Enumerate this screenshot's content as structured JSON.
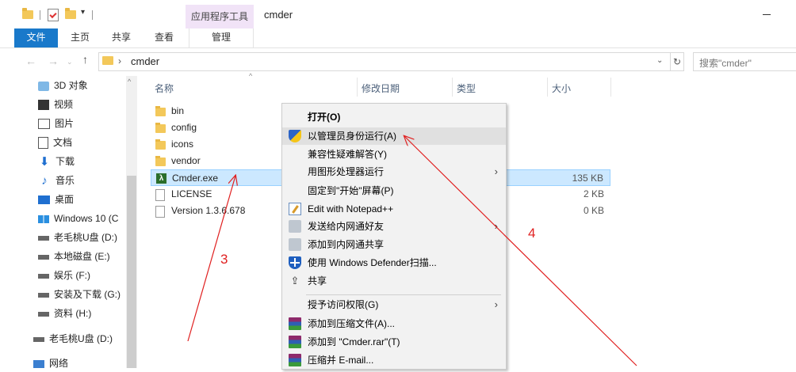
{
  "window": {
    "title": "cmder",
    "context_tab_title": "应用程序工具",
    "qa_dropdown": "▾"
  },
  "ribbon": {
    "tabs": [
      {
        "label": "文件"
      },
      {
        "label": "主页"
      },
      {
        "label": "共享"
      },
      {
        "label": "查看"
      },
      {
        "label": "管理"
      }
    ]
  },
  "address": {
    "back": "←",
    "forward": "→",
    "up": "↑",
    "chevron": "›",
    "path": "cmder",
    "dropdown": "⌄",
    "refresh": "↻",
    "search_placeholder": "搜索\"cmder\""
  },
  "sidebar": {
    "scroll_up": "^",
    "items": [
      {
        "label": "3D 对象",
        "icon": "3d-objects-icon"
      },
      {
        "label": "视频",
        "icon": "video-icon"
      },
      {
        "label": "图片",
        "icon": "pictures-icon"
      },
      {
        "label": "文档",
        "icon": "documents-icon"
      },
      {
        "label": "下载",
        "icon": "download-icon"
      },
      {
        "label": "音乐",
        "icon": "music-icon"
      },
      {
        "label": "桌面",
        "icon": "desktop-icon"
      },
      {
        "label": "Windows 10 (C",
        "icon": "windows-drive-icon"
      },
      {
        "label": "老毛桃U盘 (D:)",
        "icon": "usb-drive-icon"
      },
      {
        "label": "本地磁盘 (E:)",
        "icon": "drive-icon"
      },
      {
        "label": "娱乐 (F:)",
        "icon": "drive-icon"
      },
      {
        "label": "安装及下载 (G:)",
        "icon": "drive-icon"
      },
      {
        "label": "资料 (H:)",
        "icon": "drive-icon"
      },
      {
        "label": "老毛桃U盘 (D:)",
        "icon": "usb-drive-icon"
      },
      {
        "label": "网络",
        "icon": "network-icon"
      }
    ]
  },
  "file_list": {
    "sort_indicator": "^",
    "columns": [
      {
        "label": "名称"
      },
      {
        "label": "修改日期"
      },
      {
        "label": "类型"
      },
      {
        "label": "大小"
      }
    ],
    "rows": [
      {
        "name": "bin",
        "size": "",
        "kind": "folder"
      },
      {
        "name": "config",
        "size": "",
        "kind": "folder"
      },
      {
        "name": "icons",
        "size": "",
        "kind": "folder"
      },
      {
        "name": "vendor",
        "size": "",
        "kind": "folder"
      },
      {
        "name": "Cmder.exe",
        "size": "135 KB",
        "kind": "exe",
        "selected": true
      },
      {
        "name": "LICENSE",
        "size": "2 KB",
        "kind": "file"
      },
      {
        "name": "Version 1.3.6.678",
        "size": "0 KB",
        "kind": "file"
      }
    ],
    "exe_icon_glyph": "λ"
  },
  "context_menu": {
    "submenu_glyph": "›",
    "items": [
      {
        "label": "打开(O)",
        "bold": true,
        "icon": ""
      },
      {
        "label": "以管理员身份运行(A)",
        "icon": "uac-shield-icon",
        "hover": true
      },
      {
        "label": "兼容性疑难解答(Y)",
        "icon": ""
      },
      {
        "label": "用图形处理器运行",
        "icon": "",
        "submenu": true
      },
      {
        "label": "固定到\"开始\"屏幕(P)",
        "icon": ""
      },
      {
        "label": "Edit with Notepad++",
        "icon": "notepad-plus-icon"
      },
      {
        "label": "发送给内网通好友",
        "icon": "intranet-send-icon",
        "submenu": true
      },
      {
        "label": "添加到内网通共享",
        "icon": "intranet-share-icon"
      },
      {
        "label": "使用 Windows Defender扫描...",
        "icon": "defender-icon"
      },
      {
        "label": "共享",
        "icon": "share-icon"
      },
      {
        "label": "授予访问权限(G)",
        "icon": "",
        "submenu": true
      },
      {
        "label": "添加到压缩文件(A)...",
        "icon": "winrar-icon"
      },
      {
        "label": "添加到 \"Cmder.rar\"(T)",
        "icon": "winrar-icon"
      },
      {
        "label": "压缩并 E-mail...",
        "icon": "winrar-icon"
      }
    ]
  },
  "annotations": {
    "labels": [
      "3",
      "4"
    ],
    "color": "#e02020"
  },
  "colors": {
    "file_tab": "#1979ca",
    "context_tab": "#f1e3f7",
    "selection": "#cce8ff",
    "menu_bg": "#f2f2f2"
  }
}
